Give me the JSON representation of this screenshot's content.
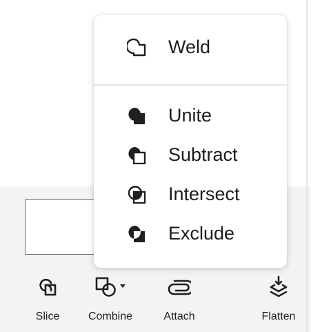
{
  "toolbar": {
    "items": [
      {
        "label": "Slice",
        "icon": "slice-icon"
      },
      {
        "label": "Combine",
        "icon": "combine-icon"
      },
      {
        "label": "Attach",
        "icon": "attach-icon"
      },
      {
        "label": "Flatten",
        "icon": "flatten-icon"
      }
    ]
  },
  "combine_menu": {
    "items": [
      {
        "label": "Weld",
        "icon": "weld-icon"
      },
      {
        "label": "Unite",
        "icon": "unite-icon"
      },
      {
        "label": "Subtract",
        "icon": "subtract-icon"
      },
      {
        "label": "Intersect",
        "icon": "intersect-icon"
      },
      {
        "label": "Exclude",
        "icon": "exclude-icon"
      }
    ]
  },
  "colors": {
    "panel_background": "#f3f3f4",
    "menu_background": "#ffffff",
    "icon_color": "#1f1f1f",
    "text_color": "#1c1c1c"
  }
}
